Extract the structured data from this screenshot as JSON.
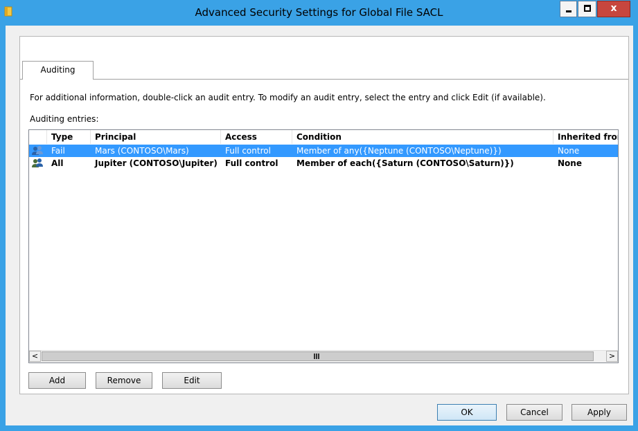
{
  "window": {
    "title": "Advanced Security Settings for Global File SACL",
    "close_glyph": "x"
  },
  "tabs": [
    {
      "label": "Auditing"
    }
  ],
  "info_text": "For additional information, double-click an audit entry. To modify an audit entry, select the entry and click Edit (if available).",
  "entries_label": "Auditing entries:",
  "table": {
    "columns": [
      "Type",
      "Principal",
      "Access",
      "Condition",
      "Inherited from"
    ],
    "rows": [
      {
        "type": "Fail",
        "principal": "Mars (CONTOSO\\Mars)",
        "access": "Full control",
        "condition": "Member of any({Neptune (CONTOSO\\Neptune)})",
        "inherited": "None",
        "selected": true,
        "icon": "users-icon"
      },
      {
        "type": "All",
        "principal": "Jupiter (CONTOSO\\Jupiter)",
        "access": "Full control",
        "condition": "Member of each({Saturn (CONTOSO\\Saturn)})",
        "inherited": "None",
        "selected": false,
        "icon": "users-icon"
      }
    ]
  },
  "scrollbar": {
    "left_arrow": "<",
    "right_arrow": ">"
  },
  "buttons": {
    "add": "Add",
    "remove": "Remove",
    "edit": "Edit",
    "ok": "OK",
    "cancel": "Cancel",
    "apply": "Apply"
  },
  "colors": {
    "title_bar": "#3aa2e6",
    "selection": "#3399ff",
    "close_button": "#c7463e"
  }
}
